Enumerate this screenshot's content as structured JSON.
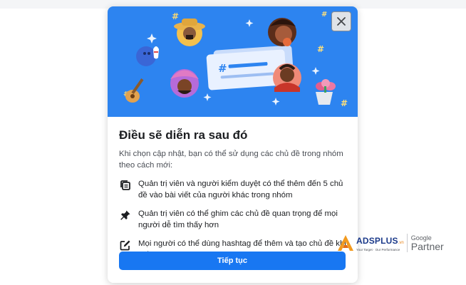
{
  "modal": {
    "hero_symbols": {
      "hash": "#",
      "sparkle": "✦"
    },
    "title": "Điều sẽ diễn ra sau đó",
    "intro": "Khi chọn cập nhật, bạn có thể sử dụng các chủ đề trong nhóm theo cách mới:",
    "features": [
      {
        "icon": "copy-posts-icon",
        "text": "Quản trị viên và người kiểm duyệt có thể thêm đến 5 chủ đề vào bài viết của người khác trong nhóm"
      },
      {
        "icon": "pin-icon",
        "text": "Quản trị viên có thể ghim các chủ đề quan trọng để mọi người dễ tìm thấy hơn"
      },
      {
        "icon": "edit-icon",
        "text": "Mọi người có thể dùng hashtag để thêm và tạo chủ đề khi viết bài"
      }
    ],
    "continue_label": "Tiếp tục",
    "accent_color": "#1877f2",
    "hero_color": "#2d84f0"
  },
  "watermark": {
    "brand": "ADSPLUS",
    "brand_suffix": ".vn",
    "tagline": "Your Target · Our Performance",
    "google": "Google",
    "partner": "Partner"
  }
}
